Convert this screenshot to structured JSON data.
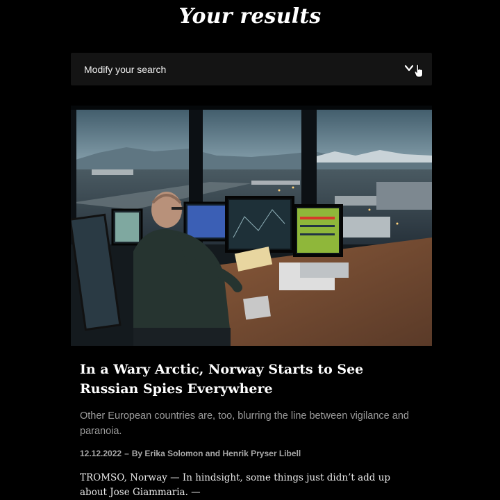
{
  "page": {
    "title": "Your results"
  },
  "search": {
    "label": "Modify your search",
    "icon": "chevron-down-icon"
  },
  "article": {
    "image_alt": "Air traffic controller in a tower overlooking an arctic airport at dusk",
    "headline": "In a Wary Arctic, Norway Starts to See Russian Spies Everywhere",
    "summary": "Other European countries are, too, blurring the line between vigilance and paranoia.",
    "date": "12.12.2022",
    "separator": "–",
    "authors": "By Erika Solomon and Henrik Pryser Libell",
    "body": "TROMSO, Norway — In hindsight, some things just didn’t add up about Jose Giammaria. —"
  },
  "colors": {
    "background": "#000000",
    "search_bar": "#141414",
    "summary_text": "#9c9c9c"
  }
}
